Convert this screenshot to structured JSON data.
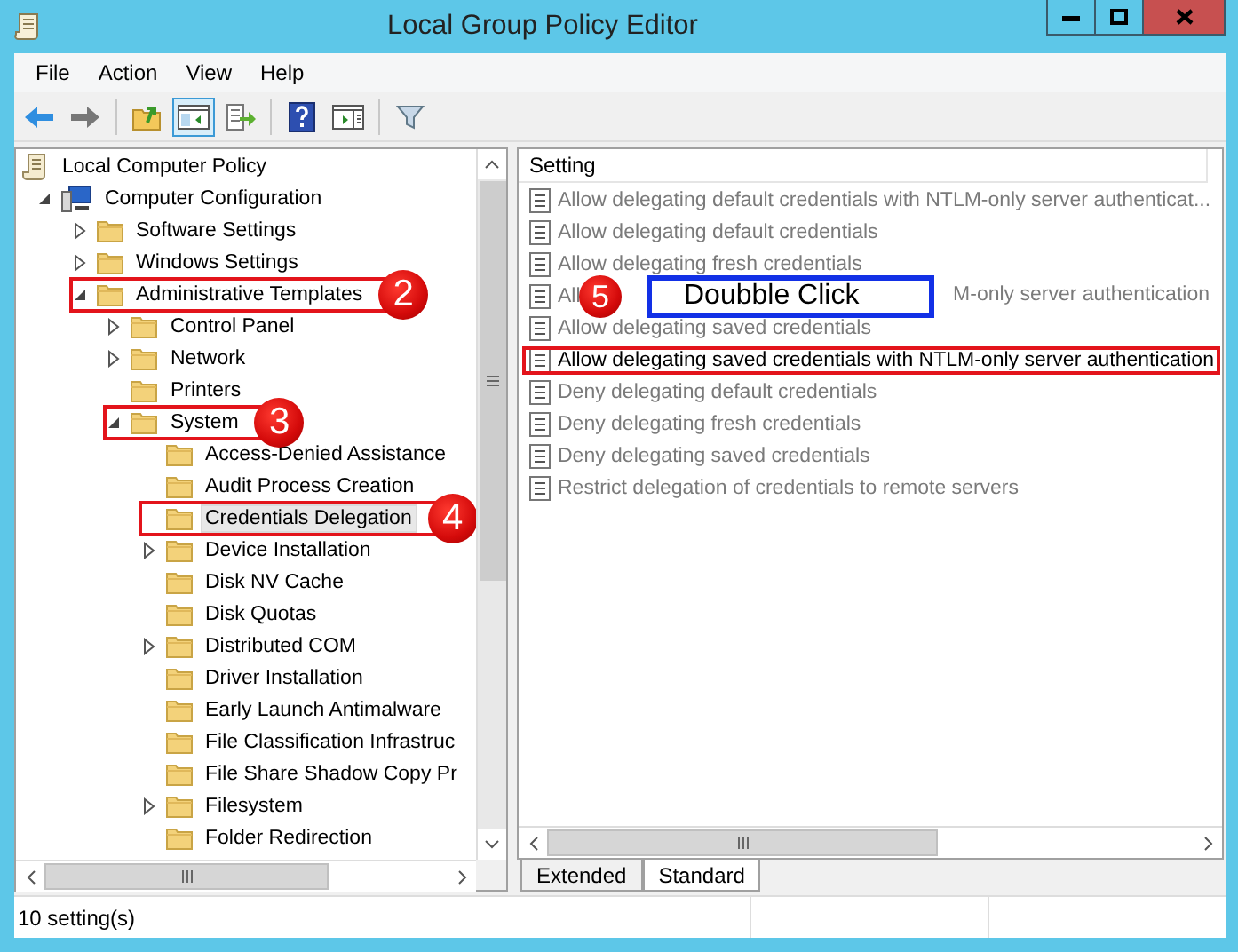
{
  "window": {
    "title": "Local Group Policy Editor"
  },
  "menu": [
    "File",
    "Action",
    "View",
    "Help"
  ],
  "toolbar": [
    {
      "kind": "back",
      "selected": false
    },
    {
      "kind": "forward",
      "selected": false
    },
    {
      "kind": "sep"
    },
    {
      "kind": "up",
      "selected": false
    },
    {
      "kind": "tree",
      "selected": true
    },
    {
      "kind": "export",
      "selected": false
    },
    {
      "kind": "sep"
    },
    {
      "kind": "help",
      "selected": false
    },
    {
      "kind": "pane",
      "selected": false
    },
    {
      "kind": "sep"
    },
    {
      "kind": "filter",
      "selected": false
    }
  ],
  "tree": [
    {
      "label": "Local Computer Policy",
      "selected": false,
      "highlighted": false,
      "children": [
        {
          "label": "Computer Configuration",
          "expanded": true,
          "selected": false,
          "highlighted": false,
          "children": [
            {
              "label": "Software Settings",
              "expanded": false,
              "selected": false,
              "highlighted": false
            },
            {
              "label": "Windows Settings",
              "expanded": false,
              "selected": false,
              "highlighted": false
            },
            {
              "label": "Administrative Templates",
              "expanded": true,
              "selected": false,
              "highlighted": true,
              "badge": "2",
              "children": [
                {
                  "label": "Control Panel",
                  "expanded": false,
                  "selected": false,
                  "highlighted": false
                },
                {
                  "label": "Network",
                  "expanded": false,
                  "selected": false,
                  "highlighted": false
                },
                {
                  "label": "Printers",
                  "selected": false,
                  "highlighted": false
                },
                {
                  "label": "System",
                  "expanded": true,
                  "selected": false,
                  "highlighted": true,
                  "badge": "3",
                  "children": [
                    {
                      "label": "Access-Denied Assistance",
                      "selected": false,
                      "highlighted": false
                    },
                    {
                      "label": "Audit Process Creation",
                      "selected": false,
                      "highlighted": false
                    },
                    {
                      "label": "Credentials Delegation",
                      "selected": true,
                      "highlighted": true,
                      "badge": "4"
                    },
                    {
                      "label": "Device Installation",
                      "expanded": false,
                      "selected": false,
                      "highlighted": false
                    },
                    {
                      "label": "Disk NV Cache",
                      "selected": false,
                      "highlighted": false
                    },
                    {
                      "label": "Disk Quotas",
                      "selected": false,
                      "highlighted": false
                    },
                    {
                      "label": "Distributed COM",
                      "expanded": false,
                      "selected": false,
                      "highlighted": false
                    },
                    {
                      "label": "Driver Installation",
                      "selected": false,
                      "highlighted": false
                    },
                    {
                      "label": "Early Launch Antimalware",
                      "selected": false,
                      "highlighted": false
                    },
                    {
                      "label": "File Classification Infrastruc",
                      "selected": false,
                      "highlighted": false
                    },
                    {
                      "label": "File Share Shadow Copy Pr",
                      "selected": false,
                      "highlighted": false
                    },
                    {
                      "label": "Filesystem",
                      "expanded": false,
                      "selected": false,
                      "highlighted": false
                    },
                    {
                      "label": "Folder Redirection",
                      "selected": false,
                      "highlighted": false
                    }
                  ]
                }
              ]
            }
          ]
        }
      ]
    }
  ],
  "settings": {
    "header": "Setting",
    "rows": [
      {
        "label": "Allow delegating default credentials with NTLM-only server authenticat...",
        "blurred": true,
        "highlighted": false
      },
      {
        "label": "Allow delegating default credentials",
        "blurred": true,
        "highlighted": false
      },
      {
        "label": "Allow delegating fresh credentials",
        "blurred": true,
        "highlighted": false
      },
      {
        "label": "All",
        "label_tail": "M-only server authentication",
        "blurred": true,
        "highlighted": false
      },
      {
        "label": "Allow delegating saved credentials",
        "blurred": true,
        "highlighted": false
      },
      {
        "label": "Allow delegating saved credentials with NTLM-only server authentication",
        "blurred": false,
        "highlighted": true
      },
      {
        "label": "Deny delegating default credentials",
        "blurred": true,
        "highlighted": false
      },
      {
        "label": "Deny delegating fresh credentials",
        "blurred": true,
        "highlighted": false
      },
      {
        "label": "Deny delegating saved credentials",
        "blurred": true,
        "highlighted": false
      },
      {
        "label": "Restrict delegation of credentials to remote servers",
        "blurred": true,
        "highlighted": false
      }
    ]
  },
  "callout": {
    "badge": "5",
    "text": "Doubble Click"
  },
  "tabs": [
    {
      "label": "Extended",
      "selected": false
    },
    {
      "label": "Standard",
      "selected": true
    }
  ],
  "status_bar": {
    "text": "10 setting(s)"
  }
}
